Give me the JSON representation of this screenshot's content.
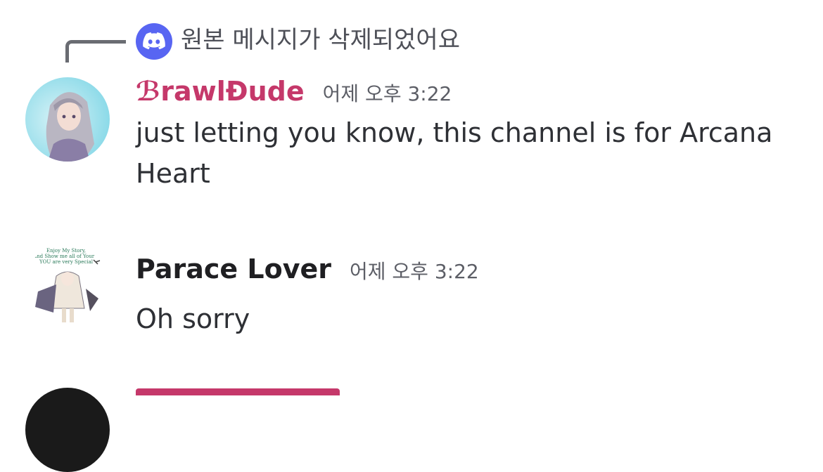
{
  "colors": {
    "brawl": "#c5386a",
    "blurple": "#5865f2",
    "cut": "#c5386a"
  },
  "reply": {
    "text": "원본 메시지가 삭제되었어요",
    "icon": "discord-logo-icon"
  },
  "messages": [
    {
      "author": "ℬrawlĐude",
      "time": "어제 오후 3:22",
      "text": "just letting you know, this channel is for Arcana Heart"
    },
    {
      "author": "Parace Lover",
      "time": "어제 오후 3:22",
      "text": "Oh sorry"
    }
  ],
  "avatar2_text": [
    "Enjoy My Story,",
    "and Show me all of Your",
    "YOU are very Special"
  ]
}
